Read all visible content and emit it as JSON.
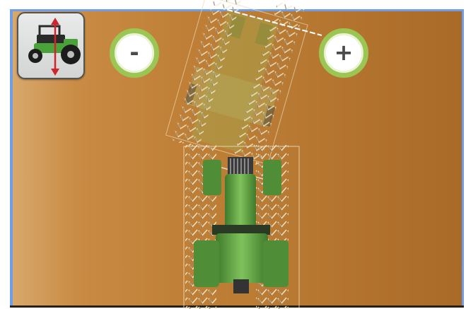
{
  "controls": {
    "toggle_view_icon": "tractor-reverse-icon",
    "zoom_out_label": "-",
    "zoom_in_label": "+"
  },
  "colors": {
    "frame_border": "#6f9ee6",
    "field_light": "#d8a86c",
    "field_dark": "#a96a28",
    "tractor_green": "#5c9a3e",
    "zoom_ring": "#9bc653",
    "direction_arrow": "#d0242a"
  }
}
